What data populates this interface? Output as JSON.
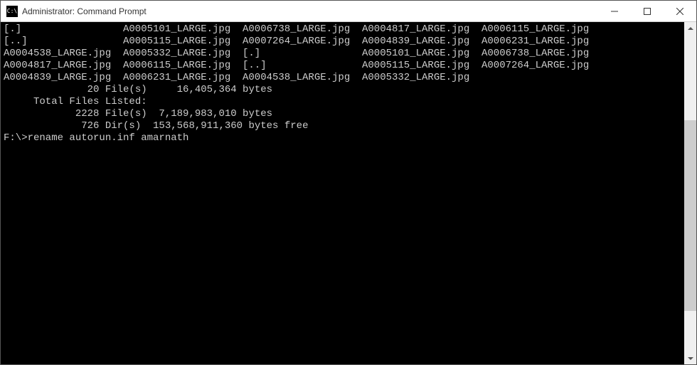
{
  "window": {
    "title": "Administrator: Command Prompt",
    "icon_label": "C:\\"
  },
  "listing": {
    "rows": [
      [
        "[.]",
        "A0005101_LARGE.jpg",
        "A0006738_LARGE.jpg",
        "A0004817_LARGE.jpg",
        "A0006115_LARGE.jpg"
      ],
      [
        "[..]",
        "A0005115_LARGE.jpg",
        "A0007264_LARGE.jpg",
        "A0004839_LARGE.jpg",
        "A0006231_LARGE.jpg"
      ],
      [
        "A0004538_LARGE.jpg",
        "A0005332_LARGE.jpg",
        "[.]",
        "A0005101_LARGE.jpg",
        "A0006738_LARGE.jpg"
      ],
      [
        "A0004817_LARGE.jpg",
        "A0006115_LARGE.jpg",
        "[..]",
        "A0005115_LARGE.jpg",
        "A0007264_LARGE.jpg"
      ],
      [
        "A0004839_LARGE.jpg",
        "A0006231_LARGE.jpg",
        "A0004538_LARGE.jpg",
        "A0005332_LARGE.jpg",
        ""
      ]
    ],
    "summary1": "              20 File(s)     16,405,364 bytes",
    "blank": "",
    "total_header": "     Total Files Listed:",
    "total_files": "            2228 File(s)  7,189,983,010 bytes",
    "total_dirs": "             726 Dir(s)  153,568,911,360 bytes free",
    "prompt_line": "F:\\>rename autorun.inf amarnath"
  }
}
